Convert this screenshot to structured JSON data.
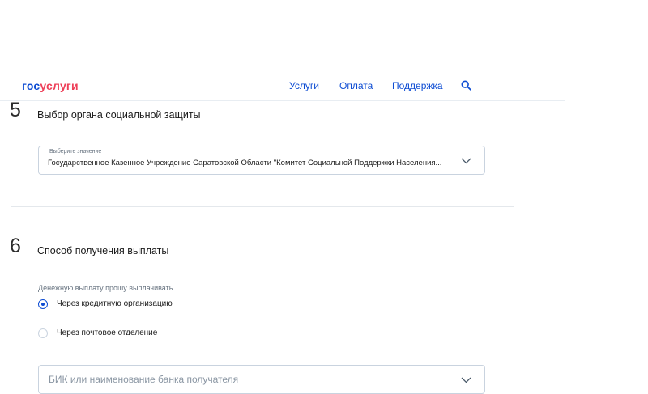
{
  "header": {
    "logo_part1": "гос",
    "logo_part2": "услуги",
    "nav": [
      "Услуги",
      "Оплата",
      "Поддержка"
    ],
    "search_icon": "search-icon"
  },
  "step5": {
    "number": "5",
    "title": "Выбор органа социальной защиты",
    "select": {
      "caption": "Выберите значение",
      "value": "Государственное Казенное Учреждение Саратовской Области \"Комитет Социальной Поддержки Населения..."
    }
  },
  "step6": {
    "number": "6",
    "title": "Способ получения выплаты",
    "field_label": "Денежную выплату прошу выплачивать",
    "options": [
      {
        "label": "Через кредитную организацию",
        "selected": true
      },
      {
        "label": "Через почтовое отделение",
        "selected": false
      }
    ],
    "bank_input": {
      "placeholder": "БИК или наименование банка получателя",
      "value": ""
    }
  },
  "colors": {
    "brand_blue": "#0d4cd3",
    "brand_red": "#ee3f58",
    "border": "#c9d3df"
  }
}
